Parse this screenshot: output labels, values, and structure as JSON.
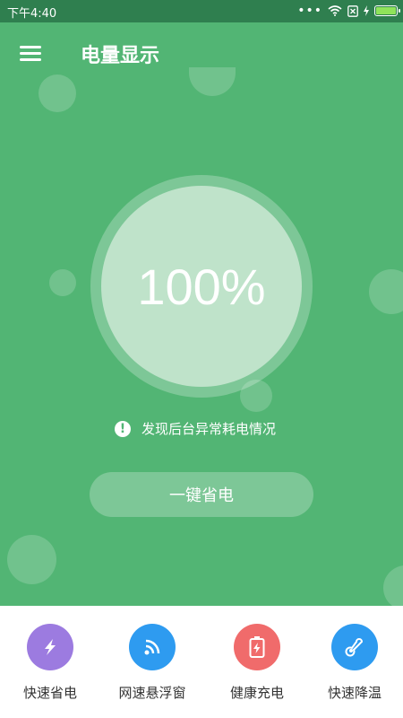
{
  "status_bar": {
    "time": "下午4:40"
  },
  "app_bar": {
    "title": "电量显示"
  },
  "battery": {
    "percent_text": "100%",
    "level_percent": 100
  },
  "warning": {
    "text": "发现后台异常耗电情况"
  },
  "main_button": {
    "label": "一键省电"
  },
  "features": [
    {
      "label": "快速省电",
      "icon": "lightning-icon",
      "color": "#9c7be0"
    },
    {
      "label": "网速悬浮窗",
      "icon": "wifi-signal-icon",
      "color": "#2e9bf0"
    },
    {
      "label": "健康充电",
      "icon": "charging-battery-icon",
      "color": "#f06b6b"
    },
    {
      "label": "快速降温",
      "icon": "thermometer-icon",
      "color": "#2e9bf0"
    }
  ],
  "colors": {
    "primary": "#52b574",
    "status_bar": "#2f7f4f"
  }
}
